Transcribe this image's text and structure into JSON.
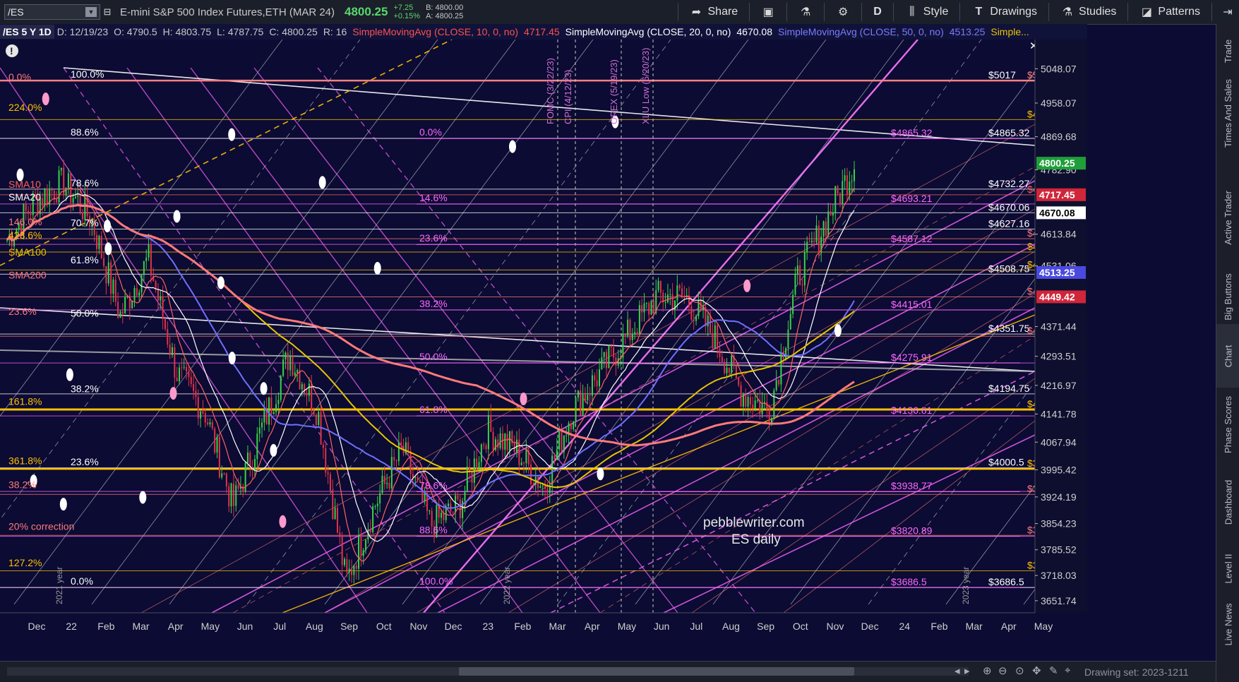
{
  "toolbar": {
    "symbol": "/ES",
    "description": "E-mini S&P 500 Index Futures,ETH (MAR 24)",
    "last_price": "4800.25",
    "change": "+7.25",
    "change_pct": "+0.15%",
    "bid": "B: 4800.00",
    "ask": "A: 4800.25",
    "share": "Share",
    "period": "D",
    "style": "Style",
    "drawings": "Drawings",
    "studies": "Studies",
    "patterns": "Patterns"
  },
  "status": {
    "chart_label": "/ES 5 Y 1D",
    "date": "D: 12/19/23",
    "open": "O: 4790.5",
    "high": "H: 4803.75",
    "low": "L: 4787.75",
    "close": "C: 4800.25",
    "range": "R: 16",
    "sma10_label": "SimpleMovingAvg (CLOSE, 10, 0, no)",
    "sma10_value": "4717.45",
    "sma20_label": "SimpleMovingAvg (CLOSE, 20, 0, no)",
    "sma20_value": "4670.08",
    "sma50_label": "SimpleMovingAvg (CLOSE, 50, 0, no)",
    "sma50_value": "4513.25",
    "more_label": "Simple..."
  },
  "colors": {
    "background": "#0b0b33",
    "candle_up": "#3bd14a",
    "candle_down": "#e0334a",
    "sma10": "#ff6060",
    "sma20": "#ffffff",
    "sma50": "#6f6fff",
    "sma100": "#e8c400",
    "sma200": "#ff7a7a",
    "fib_magenta": "#ff66ff",
    "gold": "#ffc000"
  },
  "chart_data": {
    "type": "candlestick",
    "y_ticks": [
      "5048.07",
      "4958.07",
      "4869.68",
      "4782.90",
      "4613.84",
      "4531.06",
      "4371.44",
      "4293.51",
      "4216.97",
      "4141.78",
      "4067.94",
      "3995.42",
      "3924.19",
      "3854.23",
      "3785.52",
      "3718.03",
      "3651.74"
    ],
    "ylim": [
      3620,
      5110
    ],
    "x_ticks": [
      "Dec",
      "22",
      "Feb",
      "Mar",
      "Apr",
      "May",
      "Jun",
      "Jul",
      "Aug",
      "Sep",
      "Oct",
      "Nov",
      "Dec",
      "23",
      "Feb",
      "Mar",
      "Apr",
      "May",
      "Jun",
      "Jul",
      "Aug",
      "Sep",
      "Oct",
      "Nov",
      "Dec",
      "24",
      "Feb",
      "Mar",
      "Apr",
      "May"
    ],
    "price_badges": [
      {
        "label": "4800.25",
        "value": 4800.25,
        "color": "#1f9e3a",
        "text_color": "#ffffff"
      },
      {
        "label": "4717.45",
        "value": 4717.45,
        "color": "#d0263a",
        "text_color": "#ffffff"
      },
      {
        "label": "4670.08",
        "value": 4670.08,
        "color": "#ffffff",
        "text_color": "#000000"
      },
      {
        "label": "4513.25",
        "value": 4513.25,
        "color": "#4a4ae0",
        "text_color": "#ffffff"
      },
      {
        "label": "4449.42",
        "value": 4449.42,
        "color": "#d0263a",
        "text_color": "#ffffff"
      }
    ],
    "fib_left": [
      {
        "label": "0.0%",
        "value": 5010,
        "color": "#ff7a7a"
      },
      {
        "label": "224.0%",
        "value": 4930,
        "color": "#ffc000"
      },
      {
        "label": "SMA10",
        "value": 4728,
        "color": "#ff6060"
      },
      {
        "label": "SMA20",
        "value": 4695,
        "color": "#ffffff"
      },
      {
        "label": "146.0%",
        "value": 4630,
        "color": "#ff7a7a"
      },
      {
        "label": "423.6%",
        "value": 4595,
        "color": "#ffc000"
      },
      {
        "label": "SMA100",
        "value": 4550,
        "color": "#e8c400"
      },
      {
        "label": "SMA200",
        "value": 4490,
        "color": "#ff7a7a"
      },
      {
        "label": "23.6%",
        "value": 4395,
        "color": "#ff7a7a"
      },
      {
        "label": "161.8%",
        "value": 4158,
        "color": "#ffc000"
      },
      {
        "label": "361.8%",
        "value": 4003,
        "color": "#ffc000"
      },
      {
        "label": "38.2%",
        "value": 3940,
        "color": "#ff7a7a"
      },
      {
        "label": "20% correction",
        "value": 3830,
        "color": "#ff7a7a"
      },
      {
        "label": "127.2%",
        "value": 3735,
        "color": "#ffc000"
      }
    ],
    "fib_white": [
      {
        "label": "100.0%",
        "value": 5017
      },
      {
        "label": "88.6%",
        "value": 4865
      },
      {
        "label": "78.6%",
        "value": 4732
      },
      {
        "label": "70.7%",
        "value": 4627
      },
      {
        "label": "61.8%",
        "value": 4530
      },
      {
        "label": "50.0%",
        "value": 4390
      },
      {
        "label": "38.2%",
        "value": 4192
      },
      {
        "label": "23.6%",
        "value": 4000
      },
      {
        "label": "0.0%",
        "value": 3686.5
      }
    ],
    "fib_mid": [
      {
        "label": "0.0%",
        "value": 4865
      },
      {
        "label": "14.6%",
        "value": 4693
      },
      {
        "label": "23.6%",
        "value": 4587
      },
      {
        "label": "38.2%",
        "value": 4415
      },
      {
        "label": "50.0%",
        "value": 4276
      },
      {
        "label": "61.8%",
        "value": 4137
      },
      {
        "label": "78.6%",
        "value": 3938
      },
      {
        "label": "88.6%",
        "value": 3821
      },
      {
        "label": "100.0%",
        "value": 3686.5
      }
    ],
    "levels_right": [
      {
        "label": "$5017",
        "value": 5017,
        "color": "#ffffff"
      },
      {
        "label": "$5017",
        "value": 5017,
        "color": "#ff7a7a"
      },
      {
        "label": "$4914.64",
        "value": 4914.64,
        "color": "#ffc000"
      },
      {
        "label": "$4865.32",
        "value": 4865.32,
        "color": "#ff66ff"
      },
      {
        "label": "$4865.32",
        "value": 4865.32,
        "color": "#ffffff"
      },
      {
        "label": "$4732.27",
        "value": 4732.27,
        "color": "#ffffff"
      },
      {
        "label": "$4717.45",
        "value": 4717.45,
        "color": "#ff6060"
      },
      {
        "label": "$4693.21",
        "value": 4693.21,
        "color": "#ff66ff"
      },
      {
        "label": "$4670.06",
        "value": 4670.06,
        "color": "#ffffff"
      },
      {
        "label": "$4627.16",
        "value": 4627.16,
        "color": "#ffffff"
      },
      {
        "label": "$4601.92",
        "value": 4601.92,
        "color": "#ff7a7a"
      },
      {
        "label": "$4587.12",
        "value": 4587.12,
        "color": "#ff66ff"
      },
      {
        "label": "$4567.11",
        "value": 4567.11,
        "color": "#ffc000"
      },
      {
        "label": "$4508.75",
        "value": 4508.75,
        "color": "#ffffff"
      },
      {
        "label": "$4520.01",
        "value": 4520.01,
        "color": "#ffc000"
      },
      {
        "label": "$4449.42",
        "value": 4449.42,
        "color": "#ff7a7a"
      },
      {
        "label": "$4415.01",
        "value": 4415.01,
        "color": "#ff66ff"
      },
      {
        "label": "$4351.75",
        "value": 4351.75,
        "color": "#ffffff"
      },
      {
        "label": "$4346.05",
        "value": 4346.05,
        "color": "#ff7a7a"
      },
      {
        "label": "$4275.91",
        "value": 4275.91,
        "color": "#ff66ff"
      },
      {
        "label": "$4194.75",
        "value": 4194.75,
        "color": "#ffffff"
      },
      {
        "label": "$4153.62",
        "value": 4153.62,
        "color": "#ffc000"
      },
      {
        "label": "$4136.81",
        "value": 4136.81,
        "color": "#ff66ff"
      },
      {
        "label": "$4000.5",
        "value": 4000.5,
        "color": "#ffffff"
      },
      {
        "label": "$3997.93",
        "value": 3997.93,
        "color": "#ffc000"
      },
      {
        "label": "$3938.77",
        "value": 3938.77,
        "color": "#ff66ff"
      },
      {
        "label": "$3930.97",
        "value": 3930.97,
        "color": "#ff7a7a"
      },
      {
        "label": "$3820.89",
        "value": 3820.89,
        "color": "#ff66ff"
      },
      {
        "label": "$3823.33",
        "value": 3823.33,
        "color": "#ff7a7a"
      },
      {
        "label": "$3730.29",
        "value": 3730.29,
        "color": "#ffc000"
      },
      {
        "label": "$3686.5",
        "value": 3686.5,
        "color": "#ff66ff"
      },
      {
        "label": "$3686.5",
        "value": 3686.5,
        "color": "#ffffff"
      }
    ],
    "event_labels": [
      "FOMC (3/22/23)",
      "CPI (4/12/23)",
      "OPEX (5/19/23)",
      "XLU Low (6/20/23)"
    ],
    "year_marks": [
      "2021 year",
      "2022 year",
      "2023 year"
    ],
    "watermark_line1": "pebblewriter.com",
    "watermark_line2": "ES daily"
  },
  "right_tabs": [
    "Trade",
    "Times And Sales",
    "Active Trader",
    "Big Buttons",
    "Chart",
    "Phase Scores",
    "Dashboard",
    "Level II",
    "Live News"
  ],
  "bottom": {
    "drawing_set": "Drawing set: 2023-1211"
  }
}
